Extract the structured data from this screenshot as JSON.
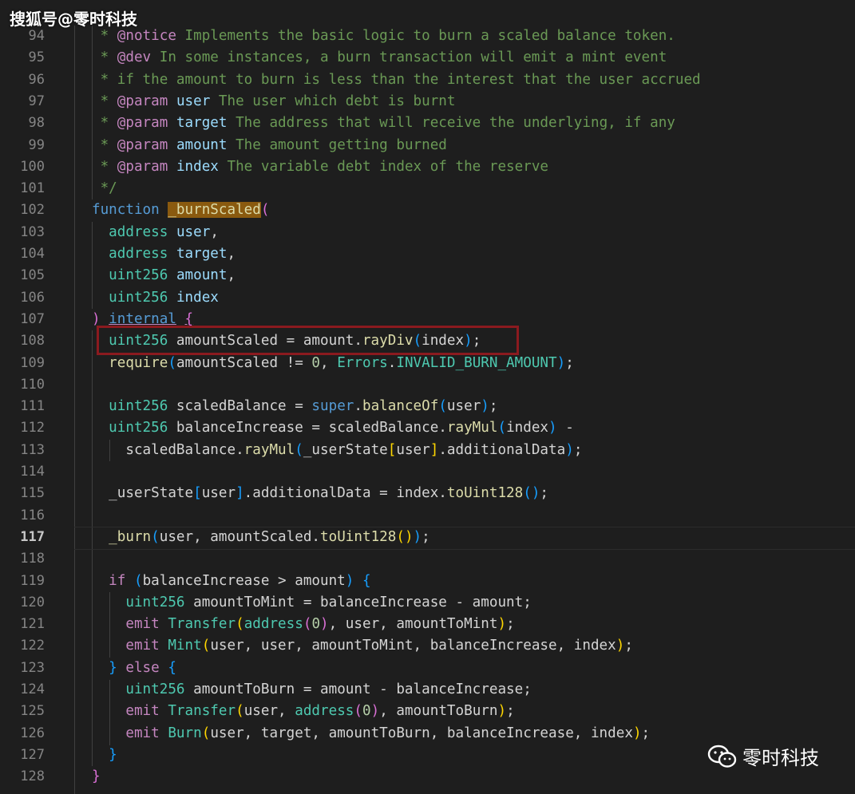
{
  "watermark": {
    "top_left": "搜狐号@零时科技",
    "bottom_right": "零时科技",
    "icon": "wechat-icon"
  },
  "editor": {
    "active_line": 117,
    "lines": [
      {
        "num": "94",
        "indent": 1,
        "tokens": [
          [
            "c-com",
            " * "
          ],
          [
            "c-kw2",
            "@notice"
          ],
          [
            "c-com",
            " Implements the basic logic to burn a scaled balance token."
          ]
        ]
      },
      {
        "num": "95",
        "indent": 1,
        "tokens": [
          [
            "c-com",
            " * "
          ],
          [
            "c-kw2",
            "@dev"
          ],
          [
            "c-com",
            " In some instances, a burn transaction will emit a mint event"
          ]
        ]
      },
      {
        "num": "96",
        "indent": 1,
        "tokens": [
          [
            "c-com",
            " * if the amount to burn is less than the interest that the user accrued"
          ]
        ]
      },
      {
        "num": "97",
        "indent": 1,
        "tokens": [
          [
            "c-com",
            " * "
          ],
          [
            "c-kw2",
            "@param"
          ],
          [
            "c-com",
            " "
          ],
          [
            "c-var",
            "user"
          ],
          [
            "c-com",
            " The user which debt is burnt"
          ]
        ]
      },
      {
        "num": "98",
        "indent": 1,
        "tokens": [
          [
            "c-com",
            " * "
          ],
          [
            "c-kw2",
            "@param"
          ],
          [
            "c-com",
            " "
          ],
          [
            "c-var",
            "target"
          ],
          [
            "c-com",
            " The address that will receive the underlying, if any"
          ]
        ]
      },
      {
        "num": "99",
        "indent": 1,
        "tokens": [
          [
            "c-com",
            " * "
          ],
          [
            "c-kw2",
            "@param"
          ],
          [
            "c-com",
            " "
          ],
          [
            "c-var",
            "amount"
          ],
          [
            "c-com",
            " The amount getting burned"
          ]
        ]
      },
      {
        "num": "100",
        "indent": 1,
        "tokens": [
          [
            "c-com",
            " * "
          ],
          [
            "c-kw2",
            "@param"
          ],
          [
            "c-com",
            " "
          ],
          [
            "c-var",
            "index"
          ],
          [
            "c-com",
            " The variable debt index of the reserve"
          ]
        ]
      },
      {
        "num": "101",
        "indent": 1,
        "tokens": [
          [
            "c-com",
            " */"
          ]
        ]
      },
      {
        "num": "102",
        "indent": 0,
        "tokens": [
          [
            "c-kw",
            "function"
          ],
          [
            "",
            "",
            " "
          ],
          [
            "c-hl",
            "_burnScaled"
          ],
          [
            "c-b2",
            "("
          ]
        ]
      },
      {
        "num": "103",
        "indent": 1,
        "tokens": [
          [
            "c-type",
            "  address"
          ],
          [
            "",
            " "
          ],
          [
            "c-var",
            "user"
          ],
          [
            "",
            ","
          ]
        ]
      },
      {
        "num": "104",
        "indent": 1,
        "tokens": [
          [
            "c-type",
            "  address"
          ],
          [
            "",
            " "
          ],
          [
            "c-var",
            "target"
          ],
          [
            "",
            ","
          ]
        ]
      },
      {
        "num": "105",
        "indent": 1,
        "tokens": [
          [
            "c-type",
            "  uint256"
          ],
          [
            "",
            " "
          ],
          [
            "c-var",
            "amount"
          ],
          [
            "",
            ","
          ]
        ]
      },
      {
        "num": "106",
        "indent": 1,
        "tokens": [
          [
            "c-type",
            "  uint256"
          ],
          [
            "",
            " "
          ],
          [
            "c-var",
            "index"
          ]
        ]
      },
      {
        "num": "107",
        "indent": 0,
        "tokens": [
          [
            "c-b2",
            ")"
          ],
          [
            "",
            " "
          ],
          [
            "c-kw c-ul",
            "internal"
          ],
          [
            "",
            " "
          ],
          [
            "c-b2 c-ul",
            "{"
          ]
        ]
      },
      {
        "num": "108",
        "indent": 1,
        "tokens": [
          [
            "c-type",
            "  uint256"
          ],
          [
            "",
            " amountScaled = amount."
          ],
          [
            "c-fn",
            "rayDiv"
          ],
          [
            "c-b3",
            "("
          ],
          [
            "",
            "index"
          ],
          [
            "c-b3",
            ")"
          ],
          [
            "",
            ";"
          ]
        ]
      },
      {
        "num": "109",
        "indent": 1,
        "tokens": [
          [
            "c-fn",
            "  require"
          ],
          [
            "c-b3",
            "("
          ],
          [
            "",
            "amountScaled != "
          ],
          [
            "c-num",
            "0"
          ],
          [
            "",
            ", "
          ],
          [
            "c-type",
            "Errors"
          ],
          [
            "",
            "."
          ],
          [
            "c-type",
            "INVALID_BURN_AMOUNT"
          ],
          [
            "c-b3",
            ")"
          ],
          [
            "",
            ";"
          ]
        ]
      },
      {
        "num": "110",
        "indent": 1,
        "tokens": [
          [
            "",
            ""
          ]
        ]
      },
      {
        "num": "111",
        "indent": 1,
        "tokens": [
          [
            "c-type",
            "  uint256"
          ],
          [
            "",
            " scaledBalance = "
          ],
          [
            "c-kw",
            "super"
          ],
          [
            "",
            "."
          ],
          [
            "c-fn",
            "balanceOf"
          ],
          [
            "c-b3",
            "("
          ],
          [
            "",
            "user"
          ],
          [
            "c-b3",
            ")"
          ],
          [
            "",
            ";"
          ]
        ]
      },
      {
        "num": "112",
        "indent": 1,
        "tokens": [
          [
            "c-type",
            "  uint256"
          ],
          [
            "",
            " balanceIncrease = scaledBalance."
          ],
          [
            "c-fn",
            "rayMul"
          ],
          [
            "c-b3",
            "("
          ],
          [
            "",
            "index"
          ],
          [
            "c-b3",
            ")"
          ],
          [
            "",
            " -"
          ]
        ]
      },
      {
        "num": "113",
        "indent": 2,
        "tokens": [
          [
            "",
            "    scaledBalance."
          ],
          [
            "c-fn",
            "rayMul"
          ],
          [
            "c-b3",
            "("
          ],
          [
            "",
            "_userState"
          ],
          [
            "c-b1",
            "["
          ],
          [
            "",
            "user"
          ],
          [
            "c-b1",
            "]"
          ],
          [
            "",
            ".additionalData"
          ],
          [
            "c-b3",
            ")"
          ],
          [
            "",
            ";"
          ]
        ]
      },
      {
        "num": "114",
        "indent": 2,
        "tokens": [
          [
            "",
            ""
          ]
        ]
      },
      {
        "num": "115",
        "indent": 1,
        "tokens": [
          [
            "",
            "  _userState"
          ],
          [
            "c-b3",
            "["
          ],
          [
            "",
            "user"
          ],
          [
            "c-b3",
            "]"
          ],
          [
            "",
            ".additionalData = index."
          ],
          [
            "c-fn",
            "toUint128"
          ],
          [
            "c-b3",
            "()"
          ],
          [
            "",
            ";"
          ]
        ]
      },
      {
        "num": "116",
        "indent": 1,
        "tokens": [
          [
            "",
            ""
          ]
        ]
      },
      {
        "num": "117",
        "indent": 1,
        "tokens": [
          [
            "c-fn",
            "  _burn"
          ],
          [
            "c-b3",
            "("
          ],
          [
            "",
            "user, amountScaled."
          ],
          [
            "c-fn",
            "toUint128"
          ],
          [
            "c-b1",
            "()"
          ],
          [
            "c-b3",
            ")"
          ],
          [
            "",
            ";"
          ]
        ]
      },
      {
        "num": "118",
        "indent": 1,
        "tokens": [
          [
            "",
            ""
          ]
        ]
      },
      {
        "num": "119",
        "indent": 1,
        "tokens": [
          [
            "c-kw2",
            "  if"
          ],
          [
            "",
            " "
          ],
          [
            "c-b3",
            "("
          ],
          [
            "",
            "balanceIncrease > amount"
          ],
          [
            "c-b3",
            ")"
          ],
          [
            "",
            " "
          ],
          [
            "c-b3",
            "{"
          ]
        ]
      },
      {
        "num": "120",
        "indent": 2,
        "tokens": [
          [
            "c-type",
            "    uint256"
          ],
          [
            "",
            " amountToMint = balanceIncrease - amount;"
          ]
        ]
      },
      {
        "num": "121",
        "indent": 2,
        "tokens": [
          [
            "c-kw2",
            "    emit"
          ],
          [
            "",
            " "
          ],
          [
            "c-type",
            "Transfer"
          ],
          [
            "c-b1",
            "("
          ],
          [
            "c-type",
            "address"
          ],
          [
            "c-b2",
            "("
          ],
          [
            "c-num",
            "0"
          ],
          [
            "c-b2",
            ")"
          ],
          [
            "",
            ", user, amountToMint"
          ],
          [
            "c-b1",
            ")"
          ],
          [
            "",
            ";"
          ]
        ]
      },
      {
        "num": "122",
        "indent": 2,
        "tokens": [
          [
            "c-kw2",
            "    emit"
          ],
          [
            "",
            " "
          ],
          [
            "c-type",
            "Mint"
          ],
          [
            "c-b1",
            "("
          ],
          [
            "",
            "user, user, amountToMint, balanceIncrease, index"
          ],
          [
            "c-b1",
            ")"
          ],
          [
            "",
            ";"
          ]
        ]
      },
      {
        "num": "123",
        "indent": 1,
        "tokens": [
          [
            "c-b3",
            "  }"
          ],
          [
            "",
            " "
          ],
          [
            "c-kw2",
            "else"
          ],
          [
            "",
            " "
          ],
          [
            "c-b3",
            "{"
          ]
        ]
      },
      {
        "num": "124",
        "indent": 2,
        "tokens": [
          [
            "c-type",
            "    uint256"
          ],
          [
            "",
            " amountToBurn = amount - balanceIncrease;"
          ]
        ]
      },
      {
        "num": "125",
        "indent": 2,
        "tokens": [
          [
            "c-kw2",
            "    emit"
          ],
          [
            "",
            " "
          ],
          [
            "c-type",
            "Transfer"
          ],
          [
            "c-b1",
            "("
          ],
          [
            "",
            "user, "
          ],
          [
            "c-type",
            "address"
          ],
          [
            "c-b2",
            "("
          ],
          [
            "c-num",
            "0"
          ],
          [
            "c-b2",
            ")"
          ],
          [
            "",
            ", amountToBurn"
          ],
          [
            "c-b1",
            ")"
          ],
          [
            "",
            ";"
          ]
        ]
      },
      {
        "num": "126",
        "indent": 2,
        "tokens": [
          [
            "c-kw2",
            "    emit"
          ],
          [
            "",
            " "
          ],
          [
            "c-type",
            "Burn"
          ],
          [
            "c-b1",
            "("
          ],
          [
            "",
            "user, target, amountToBurn, balanceIncrease, index"
          ],
          [
            "c-b1",
            ")"
          ],
          [
            "",
            ";"
          ]
        ]
      },
      {
        "num": "127",
        "indent": 1,
        "tokens": [
          [
            "c-b3",
            "  }"
          ]
        ]
      },
      {
        "num": "128",
        "indent": 0,
        "tokens": [
          [
            "c-b2",
            "}"
          ]
        ]
      }
    ]
  }
}
